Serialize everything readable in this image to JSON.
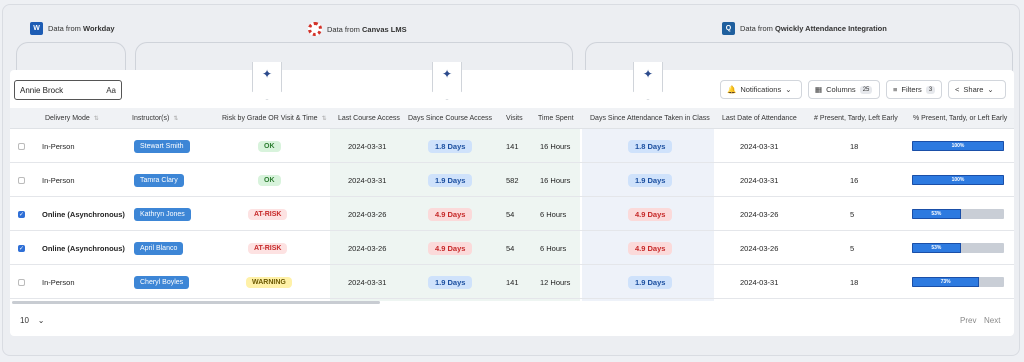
{
  "sources": {
    "workday": {
      "prefix": "Data from ",
      "name": "Workday",
      "icon": "workday-icon"
    },
    "canvas": {
      "prefix": "Data from ",
      "name": "Canvas LMS",
      "icon": "canvas-icon"
    },
    "qwickly": {
      "prefix": "Data from ",
      "name": "Qwickly Attendance Integration",
      "icon": "qwickly-icon"
    }
  },
  "search": {
    "value": "Annie Brock",
    "case_toggle": "Aa"
  },
  "toolbar": {
    "notifications": "Notifications",
    "columns": "Columns",
    "columns_count": "25",
    "filters": "Filters",
    "filters_count": "3",
    "share": "Share"
  },
  "columns": [
    "Delivery Mode",
    "Instructor(s)",
    "Risk by Grade OR Visit & Time",
    "Last Course Access",
    "Days Since Course Access",
    "Visits",
    "Time Spent",
    "Days Since Attendance Taken in Class",
    "Last Date of Attendance",
    "# Present, Tardy, Left Early",
    "% Present, Tardy, or Left Early"
  ],
  "rows": [
    {
      "checked": false,
      "mode": "In-Person",
      "instructor": "Stewart Smith",
      "risk": "OK",
      "risk_level": "ok",
      "last_access": "2024-03-31",
      "days_access": "1.8 Days",
      "days_access_status": "good",
      "visits": "141",
      "time": "16 Hours",
      "days_att": "1.8 Days",
      "last_att": "2024-03-31",
      "present": "18",
      "pct_label": "100%",
      "pct": 1.0
    },
    {
      "checked": false,
      "mode": "In-Person",
      "instructor": "Tamra Clary",
      "risk": "OK",
      "risk_level": "ok",
      "last_access": "2024-03-31",
      "days_access": "1.9 Days",
      "days_access_status": "good",
      "visits": "582",
      "time": "16 Hours",
      "days_att": "1.9 Days",
      "last_att": "2024-03-31",
      "present": "16",
      "pct_label": "100%",
      "pct": 1.0
    },
    {
      "checked": true,
      "mode": "Online (Asynchronous)",
      "instructor": "Kathryn Jones",
      "risk": "AT-RISK",
      "risk_level": "at",
      "last_access": "2024-03-26",
      "days_access": "4.9 Days",
      "days_access_status": "bad",
      "visits": "54",
      "time": "6 Hours",
      "days_att": "4.9 Days",
      "last_att": "2024-03-26",
      "present": "5",
      "pct_label": "53%",
      "pct": 0.53
    },
    {
      "checked": true,
      "mode": "Online (Asynchronous)",
      "instructor": "April Blanco",
      "risk": "AT-RISK",
      "risk_level": "at",
      "last_access": "2024-03-26",
      "days_access": "4.9 Days",
      "days_access_status": "bad",
      "visits": "54",
      "time": "6 Hours",
      "days_att": "4.9 Days",
      "last_att": "2024-03-26",
      "present": "5",
      "pct_label": "53%",
      "pct": 0.53
    },
    {
      "checked": false,
      "mode": "In-Person",
      "instructor": "Cheryl Boyles",
      "risk": "WARNING",
      "risk_level": "warn",
      "last_access": "2024-03-31",
      "days_access": "1.9 Days",
      "days_access_status": "good",
      "visits": "141",
      "time": "12 Hours",
      "days_att": "1.9 Days",
      "last_att": "2024-03-31",
      "present": "18",
      "pct_label": "73%",
      "pct": 0.73
    }
  ],
  "pager": {
    "page_size": "10",
    "prev": "Prev",
    "next": "Next"
  }
}
